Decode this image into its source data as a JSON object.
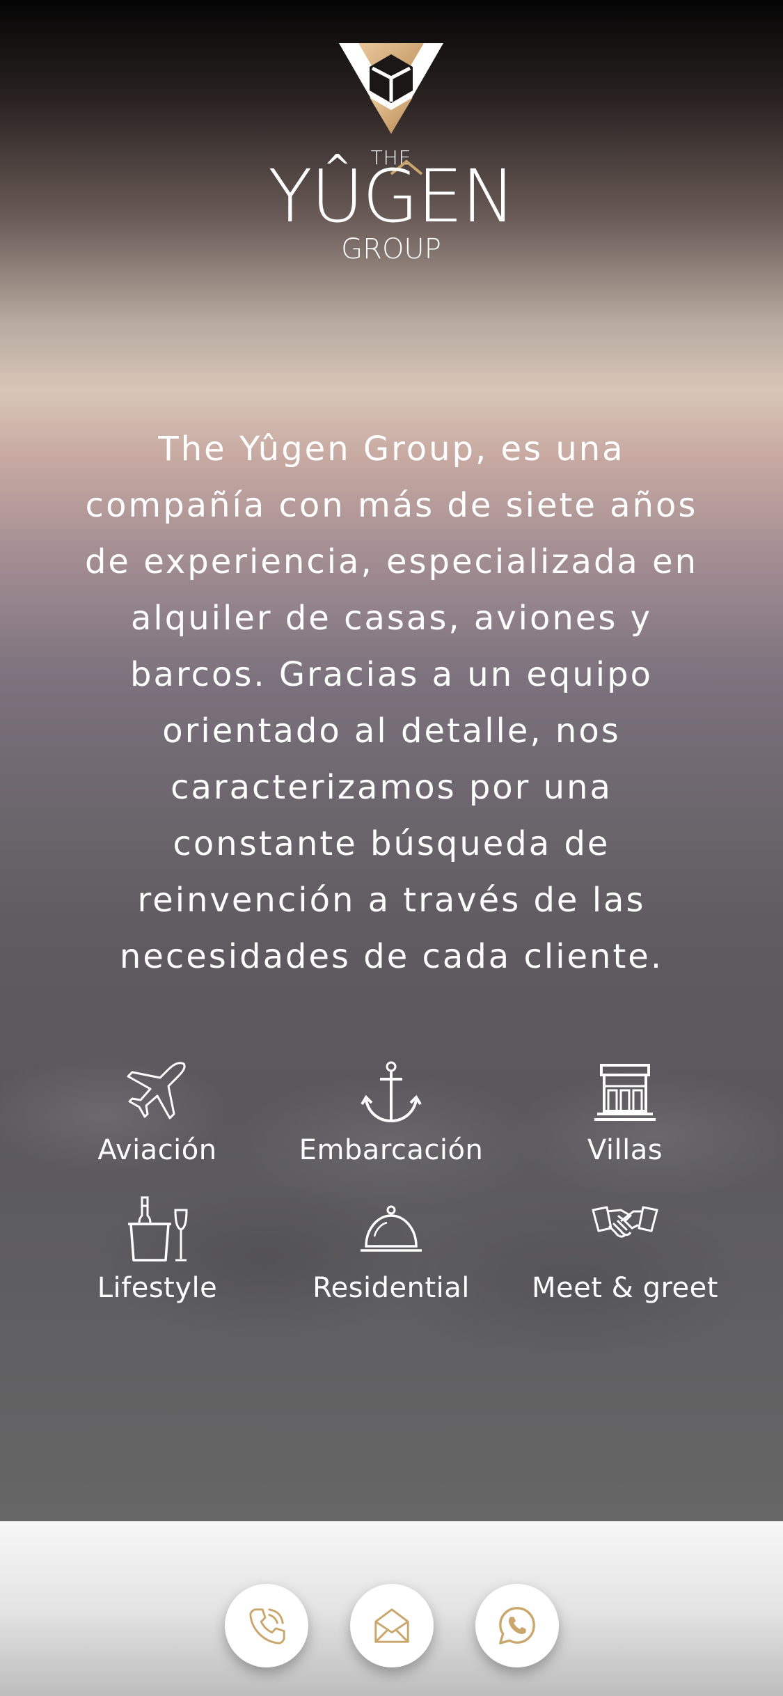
{
  "brand": {
    "the": "THE",
    "name": "YGEN",
    "group": "GROUP",
    "accent_color": "#c9a66b"
  },
  "intro_text": "The Yûgen Group, es una\ncompañía con más de siete años\nde experiencia, especializada en\nalquiler de casas, aviones y\nbarcos. Gracias a un equipo\norientado al detalle, nos\ncaracterizamos por una\nconstante búsqueda de\nreinvención a través de las\nnecesidades de cada cliente.",
  "services": [
    {
      "label": "Aviación",
      "icon": "airplane-icon"
    },
    {
      "label": "Embarcación",
      "icon": "anchor-icon"
    },
    {
      "label": "Villas",
      "icon": "villa-icon"
    },
    {
      "label": "Lifestyle",
      "icon": "champagne-icon"
    },
    {
      "label": "Residential",
      "icon": "service-bell-icon"
    },
    {
      "label": "Meet & greet",
      "icon": "handshake-icon"
    }
  ],
  "contact": [
    {
      "icon": "phone-icon"
    },
    {
      "icon": "mail-icon"
    },
    {
      "icon": "whatsapp-icon"
    }
  ]
}
